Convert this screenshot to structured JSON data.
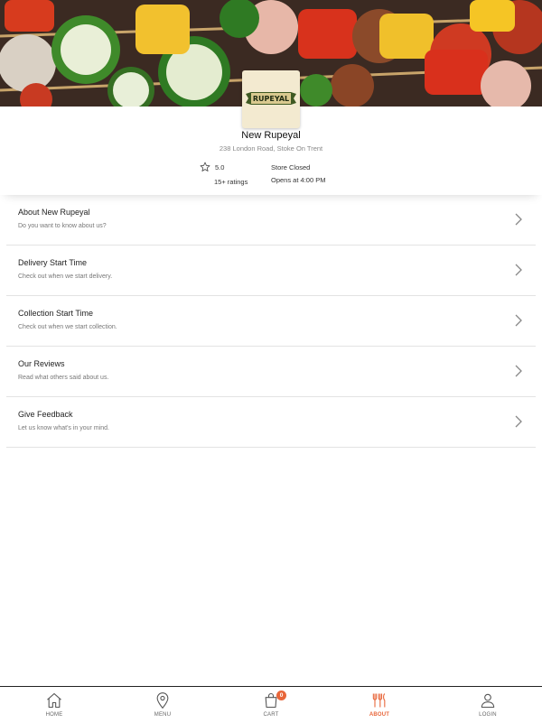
{
  "store": {
    "name": "New Rupeyal",
    "address": "238 London Road, Stoke On Trent",
    "rating": "5.0",
    "ratings_count": "15+ ratings",
    "status": "Store Closed",
    "opens": "Opens at 4:00 PM",
    "logo_text": "RUPEYAL"
  },
  "menu_items": [
    {
      "title": "About New Rupeyal",
      "subtitle": "Do you want to know about us?"
    },
    {
      "title": "Delivery Start Time",
      "subtitle": "Check out when we start delivery."
    },
    {
      "title": "Collection Start Time",
      "subtitle": "Check out when we start collection."
    },
    {
      "title": "Our Reviews",
      "subtitle": "Read what others said about us."
    },
    {
      "title": "Give Feedback",
      "subtitle": "Let us know what's in your mind."
    }
  ],
  "nav": {
    "home": "HOME",
    "menu": "MENU",
    "cart": "CART",
    "cart_count": "0",
    "about": "ABOUT",
    "login": "LOGIN"
  },
  "colors": {
    "accent": "#e8663a",
    "divider": "#e3e3e3"
  },
  "icons": [
    "star-icon",
    "chevron-right-icon",
    "home-icon",
    "map-pin-icon",
    "shopping-bag-icon",
    "cutlery-icon",
    "user-icon"
  ]
}
